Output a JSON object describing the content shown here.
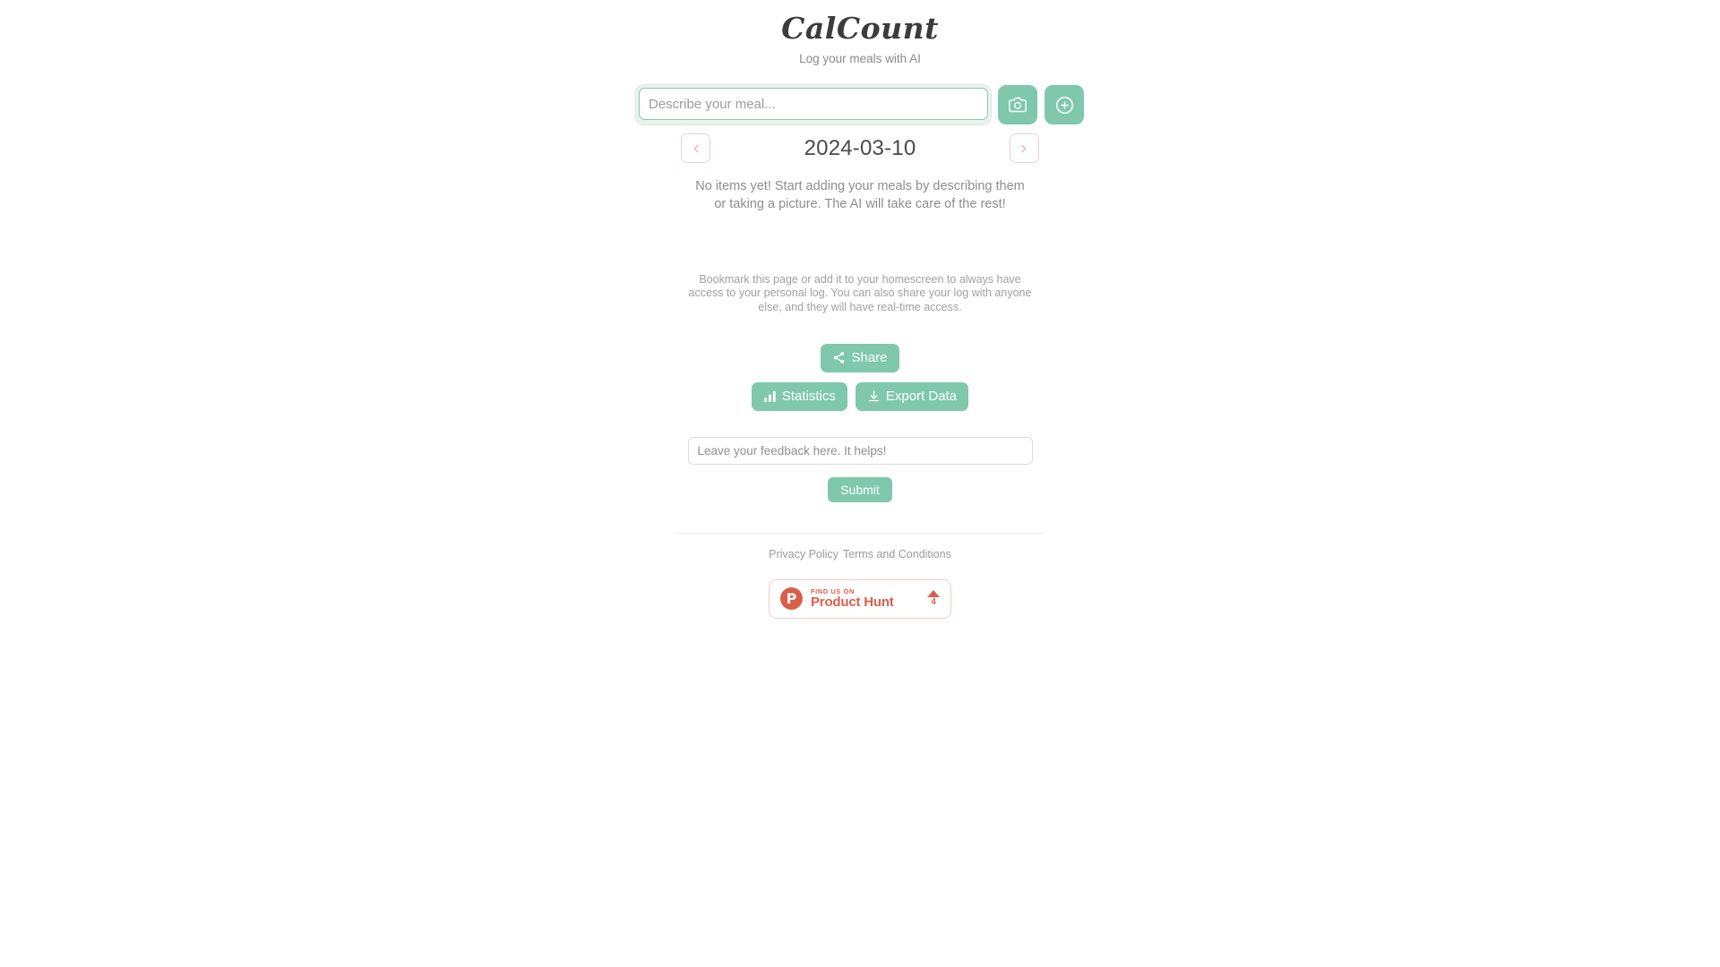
{
  "header": {
    "title": "CalCount",
    "subtitle": "Log your meals with AI"
  },
  "meal_entry": {
    "placeholder": "Describe your meal...",
    "value": "",
    "camera_icon": "camera-icon",
    "add_icon": "plus-circle-icon"
  },
  "date_nav": {
    "prev_icon": "chevron-left-icon",
    "next_icon": "chevron-right-icon",
    "current_date": "2024-03-10"
  },
  "empty_state": {
    "message": "No items yet! Start adding your meals by describing them or taking a picture. The AI will take care of the rest!"
  },
  "info": {
    "text": "Bookmark this page or add it to your homescreen to always have access to your personal log. You can also share your log with anyone else, and they will have real-time access."
  },
  "actions": {
    "share_label": "Share",
    "share_icon": "share-nodes-icon",
    "statistics_label": "Statistics",
    "statistics_icon": "bar-chart-icon",
    "export_label": "Export Data",
    "export_icon": "download-icon"
  },
  "feedback": {
    "placeholder": "Leave your feedback here. It helps!",
    "value": "",
    "submit_label": "Submit"
  },
  "footer": {
    "privacy_label": "Privacy Policy",
    "terms_label": "Terms and Conditions"
  },
  "product_hunt": {
    "kicker": "FIND US ON",
    "name": "Product Hunt",
    "logo_letter": "P",
    "upvotes": "4"
  },
  "colors": {
    "accent_green": "#7fc8ab",
    "nav_pink": "#f0cdd3",
    "product_hunt_coral": "#da5f4a",
    "text_dark": "#4a4a4a",
    "text_muted": "#8d8d8d"
  }
}
